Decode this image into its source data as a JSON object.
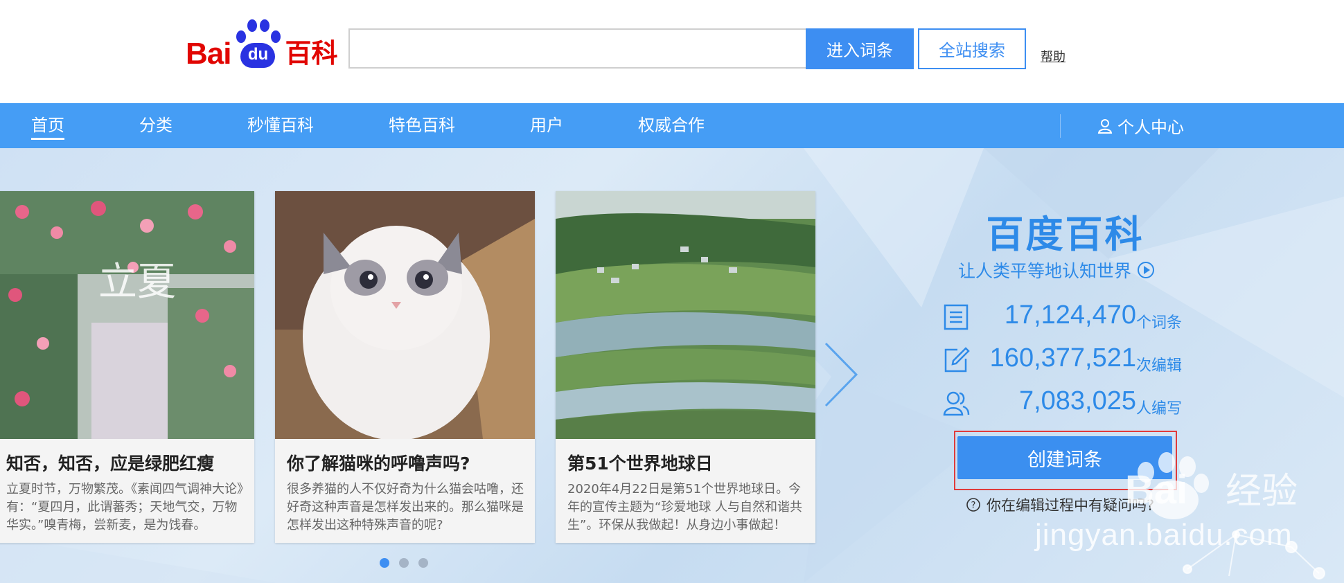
{
  "header": {
    "logo_bai": "Bai",
    "logo_du": "du",
    "logo_baike": "百科",
    "search_placeholder": "",
    "enter_button": "进入词条",
    "site_search_button": "全站搜索",
    "help_link": "帮助"
  },
  "nav": {
    "items": [
      {
        "label": "首页",
        "active": true
      },
      {
        "label": "分类"
      },
      {
        "label": "秒懂百科"
      },
      {
        "label": "特色百科"
      },
      {
        "label": "用户"
      },
      {
        "label": "权威合作"
      }
    ],
    "user_center": "个人中心"
  },
  "cards": [
    {
      "title": "知否，知否，应是绿肥红瘦",
      "desc": "立夏时节，万物繁茂。《素闻四气调神大论》有：“夏四月，此谓蕃秀；天地气交，万物华实。”嗅青梅，尝新麦，是为饯春。",
      "overlay": "立夏"
    },
    {
      "title": "你了解猫咪的呼噜声吗?",
      "desc": "很多养猫的人不仅好奇为什么猫会咕噜，还好奇这种声音是怎样发出来的。那么猫咪是怎样发出这种特殊声音的呢?"
    },
    {
      "title": "第51个世界地球日",
      "desc": "2020年4月22日是第51个世界地球日。今年的宣传主题为“珍爱地球 人与自然和谐共生”。环保从我做起！从身边小事做起！"
    }
  ],
  "carousel": {
    "dots": 3,
    "active_index": 0
  },
  "side": {
    "title": "百度百科",
    "slogan": "让人类平等地认知世界",
    "stats": [
      {
        "icon": "document-icon",
        "value": "17,124,470",
        "unit": "个词条"
      },
      {
        "icon": "edit-icon",
        "value": "160,377,521",
        "unit": "次编辑"
      },
      {
        "icon": "users-icon",
        "value": "7,083,025",
        "unit": "人编写"
      }
    ],
    "create_button": "创建词条",
    "edit_help": "你在编辑过程中有疑问吗?"
  },
  "watermark": {
    "text": "jingyan.baidu.com",
    "label": "经验"
  },
  "colors": {
    "nav_bg": "#459df5",
    "accent": "#2d8ae8",
    "logo_red": "#e10602",
    "logo_blue": "#2932e1"
  }
}
